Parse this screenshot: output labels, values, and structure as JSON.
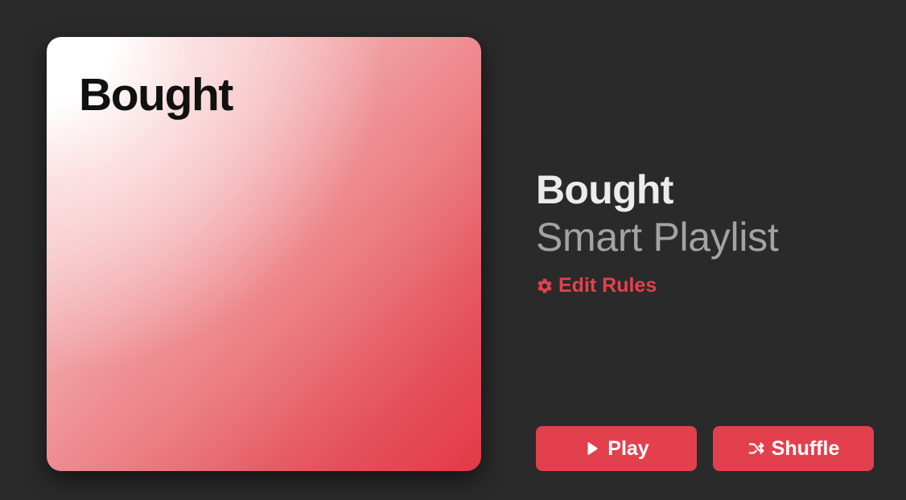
{
  "playlist": {
    "artwork_title": "Bought",
    "title": "Bought",
    "subtitle": "Smart Playlist",
    "edit_rules_label": "Edit Rules",
    "edit_rules_icon": "gear-icon"
  },
  "actions": {
    "play_label": "Play",
    "play_icon": "play-icon",
    "shuffle_label": "Shuffle",
    "shuffle_icon": "shuffle-icon"
  },
  "colors": {
    "background": "#2a2a2a",
    "accent": "#e3404e",
    "title_text": "#ececec",
    "subtitle_text": "#a3a3a3",
    "artwork_gradient_start": "#ffffff",
    "artwork_gradient_end": "#e23a47"
  }
}
